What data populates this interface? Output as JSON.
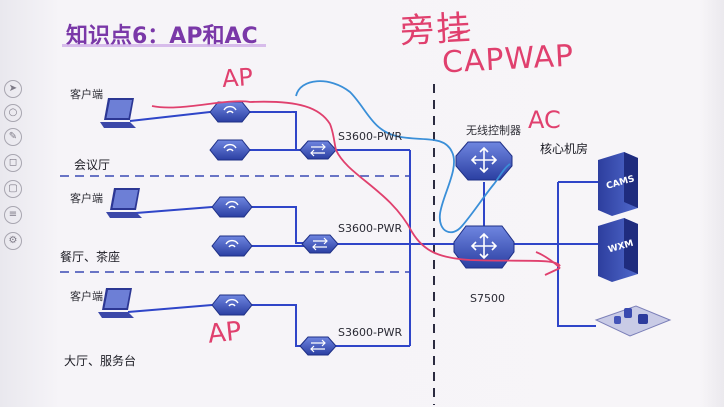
{
  "slide": {
    "title": "知识点6：AP和AC",
    "areas": [
      {
        "client_label": "客户端",
        "area_label": "会议厅"
      },
      {
        "client_label": "客户端",
        "area_label": "餐厅、茶座"
      },
      {
        "client_label": "客户端",
        "area_label": "大厅、服务台"
      }
    ],
    "access_switch_model": "S3600-PWR",
    "ac_label": "无线控制器",
    "core_room_label": "核心机房",
    "core_switch_model": "S7500",
    "servers": [
      {
        "label": "CAMS",
        "icon": "cams-server-icon"
      },
      {
        "label": "WXM",
        "icon": "wxm-server-icon"
      }
    ]
  },
  "annotations": {
    "ap_top": "AP",
    "ap_bottom": "AP",
    "ac": "AC",
    "bypass": "旁挂",
    "protocol": "CAPWAP"
  },
  "colors": {
    "title": "#7a38a8",
    "link": "#2f45c8",
    "annotation": "#e0406e",
    "highlight": "#3a8fd8",
    "device": "#3a56b8"
  }
}
